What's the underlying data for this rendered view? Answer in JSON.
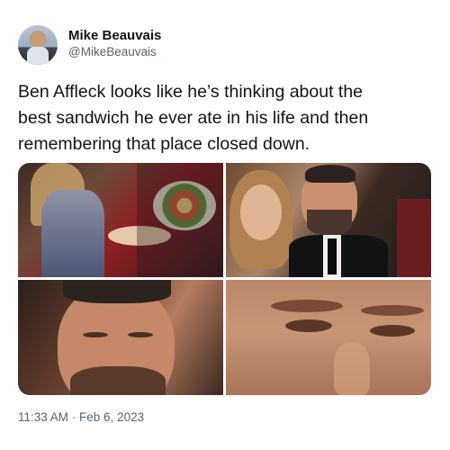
{
  "author": {
    "name": "Mike Beauvais",
    "handle": "@MikeBeauvais"
  },
  "tweet": {
    "lines": [
      "Ben Affleck looks like he’s thinking about the",
      "best sandwich he ever ate in his life and then",
      "remembering that place closed down."
    ],
    "timestamp": "11:33 AM · Feb 6, 2023"
  },
  "media": {
    "count": 4
  }
}
